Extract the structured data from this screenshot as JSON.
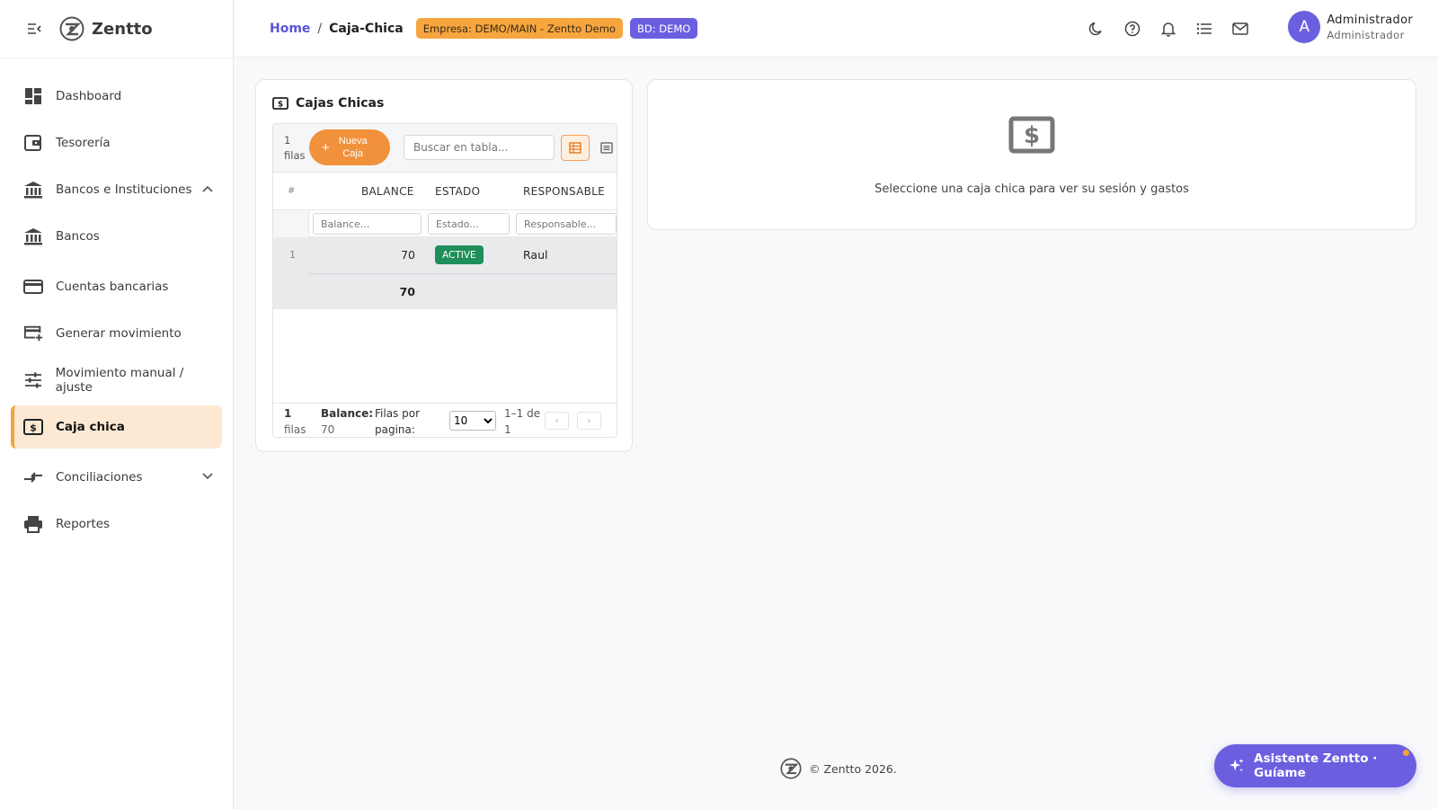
{
  "app": {
    "brand": "Zentto"
  },
  "sidebar": {
    "items": [
      {
        "label": "Dashboard",
        "icon": "dashboard-icon"
      },
      {
        "label": "Tesorería",
        "icon": "wallet-icon"
      },
      {
        "label": "Bancos e Instituciones",
        "icon": "bank-icon",
        "expanded": true
      },
      {
        "label": "Bancos",
        "icon": "bank-icon"
      },
      {
        "label": "Cuentas bancarias",
        "icon": "credit-card-icon"
      },
      {
        "label": "Generar movimiento",
        "icon": "card-add-icon"
      },
      {
        "label": "Movimiento manual / ajuste",
        "icon": "sliders-icon"
      },
      {
        "label": "Caja chica",
        "icon": "cash-icon",
        "active": true
      },
      {
        "label": "Conciliaciones",
        "icon": "compare-arrows-icon",
        "expanded": false
      },
      {
        "label": "Reportes",
        "icon": "printer-icon"
      }
    ]
  },
  "header": {
    "breadcrumb_home": "Home",
    "breadcrumb_sep": "/",
    "breadcrumb_current": "Caja-Chica",
    "company_chip": "Empresa: DEMO/MAIN - Zentto Demo",
    "db_chip": "BD: DEMO",
    "icons": [
      "moon-icon",
      "help-icon",
      "bell-icon",
      "list-icon",
      "mail-icon"
    ],
    "user": {
      "initial": "A",
      "name": "Administrador",
      "role": "Administrador"
    }
  },
  "cajas": {
    "title": "Cajas Chicas",
    "toolbar": {
      "rows_count_num": "1",
      "rows_count_label": "filas",
      "new_button_line1": "Nueva",
      "new_button_line2": "Caja",
      "search_placeholder": "Buscar en tabla..."
    },
    "columns": {
      "num": "#",
      "balance": "BALANCE",
      "estado": "ESTADO",
      "responsable": "RESPONSABLE"
    },
    "filters": {
      "balance": "Balance...",
      "estado": "Estado...",
      "responsable": "Responsable..."
    },
    "rows": [
      {
        "num": "1",
        "balance": "70",
        "estado": "ACTIVE",
        "responsable": "Raul"
      }
    ],
    "total_balance": "70",
    "footer": {
      "rows_num": "1",
      "rows_label": "filas",
      "balance_label": "Balance:",
      "balance_value": "70",
      "per_page_line1": "Filas por",
      "per_page_line2": "pagina:",
      "per_page_value": "10",
      "range_line1": "1–1 de",
      "range_line2": "1",
      "prev": "‹",
      "next": "›"
    }
  },
  "detail": {
    "empty_message": "Seleccione una caja chica para ver su sesión y gastos"
  },
  "page_footer": {
    "copyright": "© Zentto 2026."
  },
  "assistant": {
    "label": "Asistente Zentto · Guíame"
  },
  "colors": {
    "accent": "#6b5fe0",
    "orange": "#f2913b",
    "active_bg": "#fde9d3",
    "badge_green": "#1e8e5a"
  }
}
